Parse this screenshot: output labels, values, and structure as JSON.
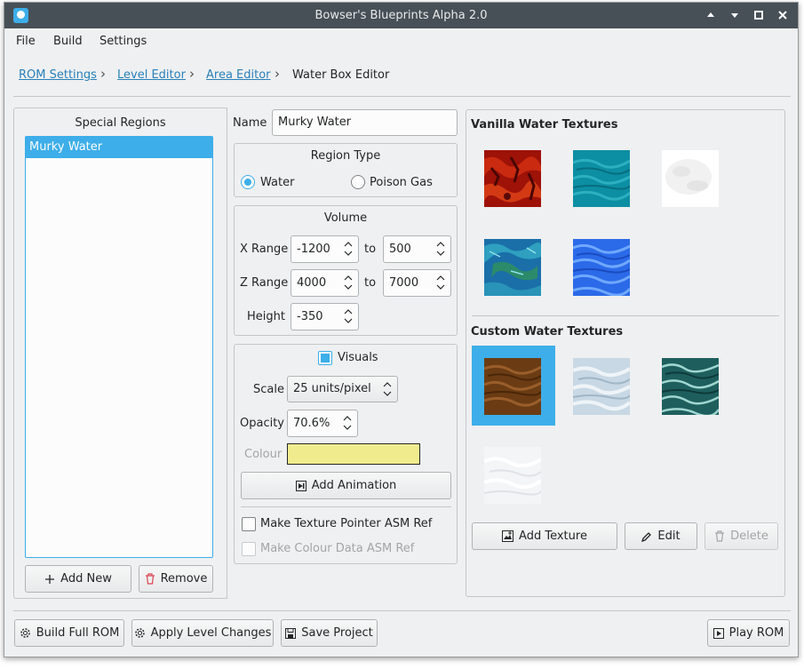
{
  "window": {
    "title": "Bowser's Blueprints Alpha 2.0"
  },
  "menu": {
    "file": "File",
    "build": "Build",
    "settings": "Settings"
  },
  "breadcrumb": {
    "rom_settings": "ROM Settings",
    "level_editor": "Level Editor",
    "area_editor": "Area Editor",
    "current": "Water Box Editor"
  },
  "special_regions": {
    "title": "Special Regions",
    "items": [
      "Murky Water"
    ],
    "add_label": "Add New",
    "remove_label": "Remove"
  },
  "properties": {
    "name_label": "Name",
    "name_value": "Murky Water",
    "region_type": {
      "title": "Region Type",
      "water": "Water",
      "poison_gas": "Poison Gas",
      "selected": "Water"
    },
    "volume": {
      "title": "Volume",
      "x_range_label": "X Range",
      "x_min": "-1200",
      "x_max": "500",
      "z_range_label": "Z Range",
      "z_min": "4000",
      "z_max": "7000",
      "to": "to",
      "height_label": "Height",
      "height": "-350"
    },
    "visuals": {
      "title": "Visuals",
      "checked": true,
      "scale_label": "Scale",
      "scale_value": "25 units/pixel",
      "opacity_label": "Opacity",
      "opacity_value": "70.6%",
      "colour_label": "Colour",
      "colour_value": "#f0ec8e",
      "add_animation": "Add Animation",
      "texture_pointer_label": "Make Texture Pointer ASM Ref",
      "colour_data_label": "Make Colour Data ASM Ref"
    }
  },
  "textures": {
    "vanilla_title": "Vanilla Water Textures",
    "custom_title": "Custom Water Textures",
    "vanilla": [
      "lava",
      "teal-water",
      "white-mist",
      "blue-green-water",
      "bright-blue-water"
    ],
    "custom": [
      "brown-water",
      "ice-water",
      "dark-teal-water",
      "white-cloud"
    ],
    "selected_custom": "brown-water",
    "add_texture": "Add Texture",
    "edit": "Edit",
    "delete": "Delete"
  },
  "footer": {
    "build_full_rom": "Build Full ROM",
    "apply_level_changes": "Apply Level Changes",
    "save_project": "Save Project",
    "play_rom": "Play ROM"
  },
  "colors": {
    "accent": "#3daee9",
    "link": "#2980b9",
    "titlebar": "#475057"
  }
}
